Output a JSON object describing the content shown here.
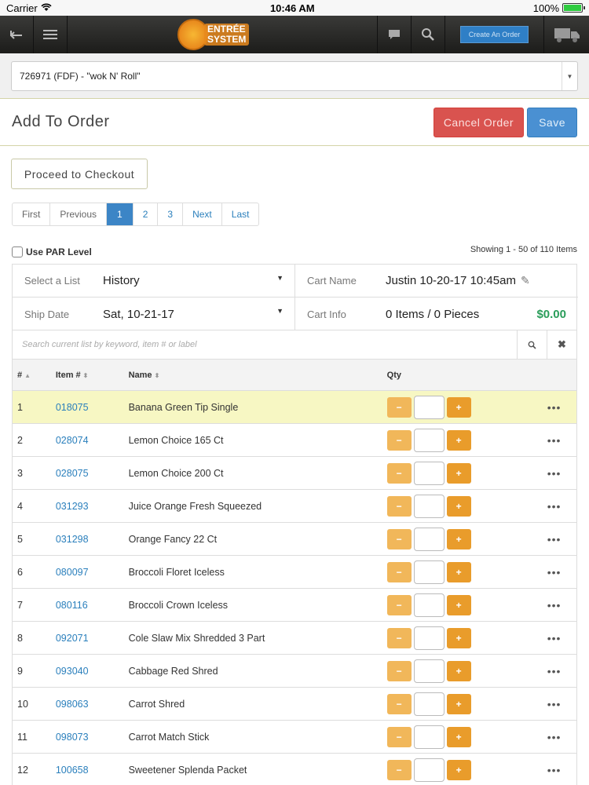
{
  "status_bar": {
    "carrier": "Carrier",
    "time": "10:46 AM",
    "battery": "100%"
  },
  "navbar": {
    "logo_top": "ENTRÉE",
    "logo_bottom": "SYSTEM",
    "create_order": "Create An Order"
  },
  "customer": {
    "selected": "726971 (FDF) - \"wok N' Roll\""
  },
  "header": {
    "title": "Add To Order",
    "cancel": "Cancel Order",
    "save": "Save"
  },
  "checkout": "Proceed to Checkout",
  "pagination": {
    "first": "First",
    "previous": "Previous",
    "pages": [
      "1",
      "2",
      "3"
    ],
    "next": "Next",
    "last": "Last"
  },
  "par_label": "Use PAR Level",
  "showing": "Showing 1 - 50 of 110 Items",
  "info": {
    "list_label": "Select a List",
    "list_value": "History",
    "cart_label": "Cart Name",
    "cart_value": "Justin 10-20-17 10:45am",
    "ship_label": "Ship Date",
    "ship_value": "Sat, 10-21-17",
    "cartinfo_label": "Cart Info",
    "cartinfo_value": "0 Items / 0 Pieces",
    "total": "$0.00"
  },
  "search": {
    "placeholder": "Search current list by keyword, item # or label"
  },
  "table": {
    "headers": {
      "num": "#",
      "item": "Item #",
      "name": "Name",
      "qty": "Qty"
    },
    "rows": [
      {
        "num": "1",
        "item": "018075",
        "name": "Banana Green Tip Single"
      },
      {
        "num": "2",
        "item": "028074",
        "name": "Lemon Choice 165 Ct"
      },
      {
        "num": "3",
        "item": "028075",
        "name": "Lemon Choice 200 Ct"
      },
      {
        "num": "4",
        "item": "031293",
        "name": "Juice Orange Fresh Squeezed"
      },
      {
        "num": "5",
        "item": "031298",
        "name": "Orange Fancy 22 Ct"
      },
      {
        "num": "6",
        "item": "080097",
        "name": "Broccoli Floret Iceless"
      },
      {
        "num": "7",
        "item": "080116",
        "name": "Broccoli Crown Iceless"
      },
      {
        "num": "8",
        "item": "092071",
        "name": "Cole Slaw Mix Shredded 3 Part"
      },
      {
        "num": "9",
        "item": "093040",
        "name": "Cabbage Red Shred"
      },
      {
        "num": "10",
        "item": "098063",
        "name": "Carrot Shred"
      },
      {
        "num": "11",
        "item": "098073",
        "name": "Carrot Match Stick"
      },
      {
        "num": "12",
        "item": "100658",
        "name": "Sweetener Splenda Packet"
      }
    ]
  }
}
